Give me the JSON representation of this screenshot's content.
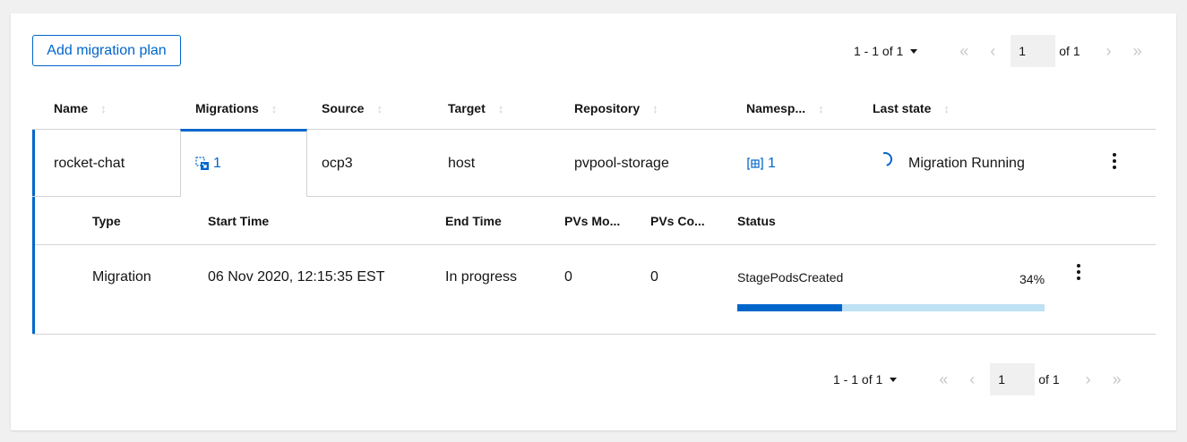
{
  "toolbar": {
    "add_label": "Add migration plan"
  },
  "pagination_top": {
    "count_label": "1 - 1 of 1",
    "page_value": "1",
    "of_label": "of 1"
  },
  "pagination_bottom": {
    "count_label": "1 - 1 of 1",
    "page_value": "1",
    "of_label": "of 1"
  },
  "table": {
    "columns": [
      "Name",
      "Migrations",
      "Source",
      "Target",
      "Repository",
      "Namesp...",
      "Last state"
    ],
    "rows": [
      {
        "name": "rocket-chat",
        "migrations": "1",
        "source": "ocp3",
        "target": "host",
        "repository": "pvpool-storage",
        "namespaces": "1",
        "last_state": "Migration Running"
      }
    ]
  },
  "migrations_table": {
    "columns": [
      "Type",
      "Start Time",
      "End Time",
      "PVs Mo...",
      "PVs Co...",
      "Status"
    ],
    "rows": [
      {
        "type": "Migration",
        "start_time": "06 Nov 2020, 12:15:35 EST",
        "end_time": "In progress",
        "pvs_moved": "0",
        "pvs_copied": "0",
        "status": "StagePodsCreated",
        "progress_label": "34%",
        "progress": 0.34
      }
    ]
  },
  "icons": {
    "sort": "sort-icon",
    "migrations": "migration-icon",
    "namespaces": "namespace-icon",
    "spinner": "spinner-icon",
    "kebab": "kebab-icon"
  },
  "colors": {
    "accent": "#0066cc",
    "progress_track": "#bee1f4",
    "border": "#d2d2d2"
  }
}
